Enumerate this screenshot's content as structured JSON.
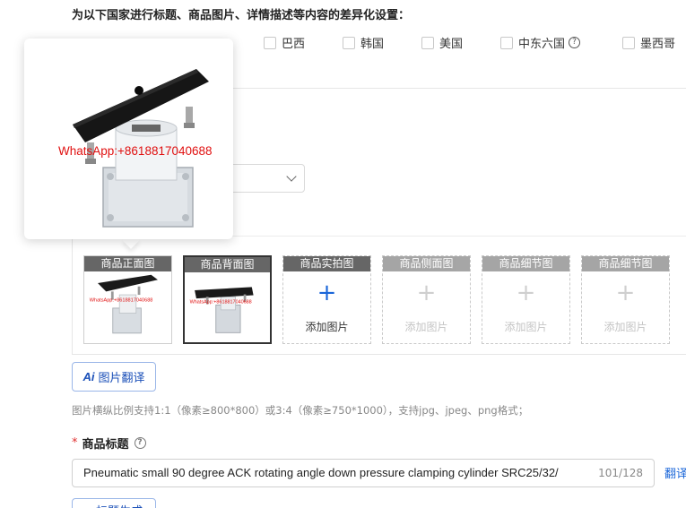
{
  "section_heading": "为以下国家进行标题、商品图片、详情描述等内容的差异化设置：",
  "countries": [
    {
      "label": "巴西"
    },
    {
      "label": "韩国"
    },
    {
      "label": "美国"
    },
    {
      "label": "中东六国",
      "has_help": true
    },
    {
      "label": "墨西哥"
    }
  ],
  "image_slots": [
    {
      "label": "商品正面图",
      "state": "filled"
    },
    {
      "label": "商品背面图",
      "state": "filled-selected"
    },
    {
      "label": "商品实拍图",
      "state": "add",
      "add_text": "添加图片"
    },
    {
      "label": "商品侧面图",
      "state": "disabled",
      "add_text": "添加图片"
    },
    {
      "label": "商品细节图",
      "state": "disabled",
      "add_text": "添加图片"
    },
    {
      "label": "商品细节图",
      "state": "disabled",
      "add_text": "添加图片"
    }
  ],
  "image_translate_button": {
    "icon": "ai-icon",
    "label": "图片翻译"
  },
  "image_hint": "图片横纵比例支持1:1（像素≥800*800）或3:4（像素≥750*1000），支持jpg、jpeg、png格式；",
  "product_title": {
    "required_mark": "*",
    "label": "商品标题",
    "value": "Pneumatic small 90 degree ACK rotating angle down pressure clamping cylinder SRC25/32/",
    "counter": "101/128",
    "translate_link": "翻译"
  },
  "title_generate_button": {
    "label": "标题生成"
  },
  "preview_popover": {
    "watermark": "WhatsApp:+8618817040688",
    "thumb_watermark": "WhatsApp:+8618817040688"
  },
  "colors": {
    "accent": "#1a66d9",
    "required": "#e03030",
    "slot_label_bg": "#666666"
  }
}
